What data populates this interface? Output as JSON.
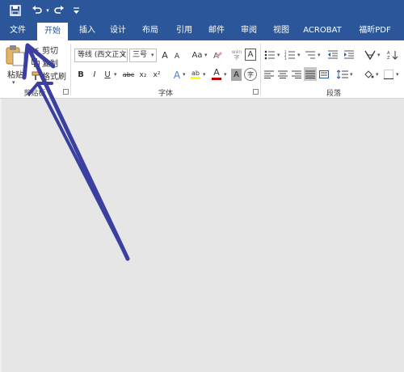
{
  "quick_access": {
    "save_icon": "save-icon",
    "undo_icon": "undo-icon",
    "redo_icon": "redo-icon",
    "customize_icon": "customize-icon"
  },
  "tabs": [
    "文件",
    "开始",
    "插入",
    "设计",
    "布局",
    "引用",
    "邮件",
    "审阅",
    "视图",
    "ACROBAT",
    "福昕PDF"
  ],
  "active_tab": "开始",
  "clipboard": {
    "paste_label": "粘贴",
    "cut_label": "剪切",
    "copy_label": "复制",
    "format_painter_label": "格式刷",
    "group_label": "剪贴板"
  },
  "font": {
    "font_name": "等线 (西文正文",
    "font_size": "三号",
    "grow_label": "A",
    "shrink_label": "A",
    "case_label": "Aa",
    "phonetic_label": "wén",
    "border_char_label": "A",
    "bold_label": "B",
    "italic_label": "I",
    "underline_label": "U",
    "strike_label": "abc",
    "subscript_label": "x₂",
    "superscript_label": "x²",
    "effects_label": "A",
    "highlight_label": "ab",
    "color_label": "A",
    "shading_label": "A",
    "enclose_label": "字",
    "group_label": "字体"
  },
  "paragraph": {
    "group_label": "段落"
  },
  "colors": {
    "brand": "#2b579a",
    "highlight": "#ffff00",
    "font_color": "#c00000",
    "annotation": "#3a3fa0"
  }
}
